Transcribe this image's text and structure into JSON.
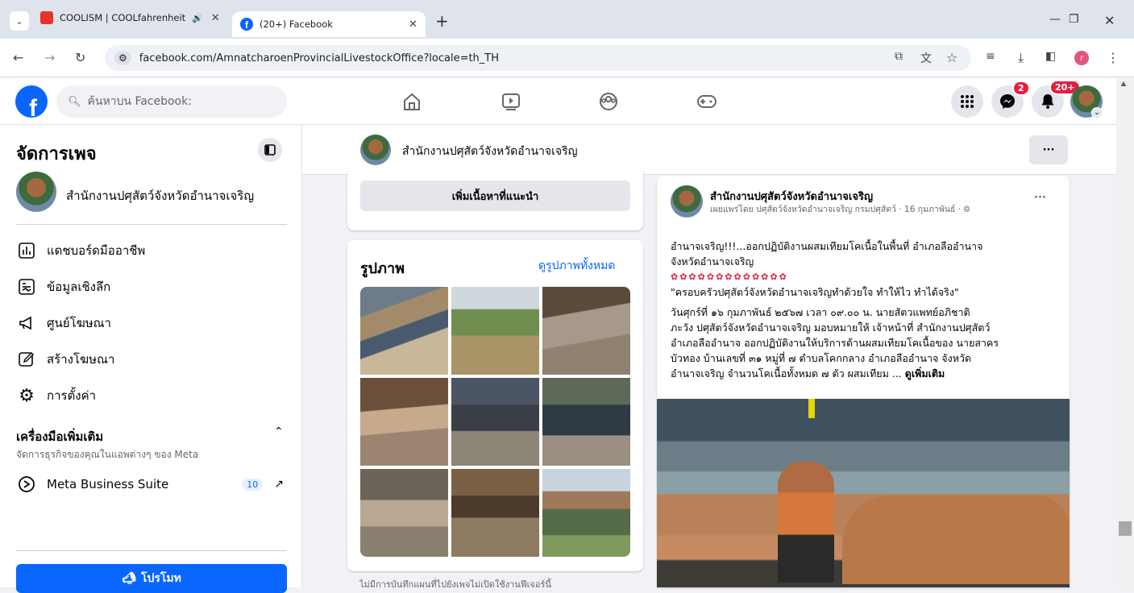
{
  "browser": {
    "tabs": [
      {
        "title": "COOLISM | COOLfahrenheit"
      },
      {
        "title": "(20+) Facebook"
      }
    ],
    "new_tab": "+",
    "url": "facebook.com/AmnatcharoenProvincialLivestockOffice?locale=th_TH"
  },
  "fb": {
    "search_placeholder": "ค้นหาบน Facebook:",
    "messenger_badge": "2",
    "notif_badge": "20+"
  },
  "left": {
    "title": "จัดการเพจ",
    "page_name": "สำนักงานปศุสัตว์จังหวัดอำนาจเจริญ",
    "menu": [
      {
        "label": "แดชบอร์ดมืออาชีพ",
        "icon": "dashboard-icon"
      },
      {
        "label": "ข้อมูลเชิงลึก",
        "icon": "insights-icon"
      },
      {
        "label": "ศูนย์โฆษณา",
        "icon": "megaphone-icon"
      },
      {
        "label": "สร้างโฆษณา",
        "icon": "edit-icon"
      },
      {
        "label": "การตั้งค่า",
        "icon": "gear-icon"
      }
    ],
    "tools_title": "เครื่องมือเพิ่มเติม",
    "tools_sub": "จัดการธุรกิจของคุณในแอพต่างๆ ของ Meta",
    "mbs_label": "Meta Business Suite",
    "mbs_count": "10",
    "promote": "โปรโมท"
  },
  "page_header": {
    "name": "สำนักงานปศุสัตว์จังหวัดอำนาจเจริญ",
    "more": "···"
  },
  "recommend_button": "เพิ่มเนื้อหาที่แนะนำ",
  "photos": {
    "title": "รูปภาพ",
    "see_all": "ดูรูปภาพทั้งหมด",
    "bottom_text": "ไม่มีการบันทึกแผนที่ไปยังเพจไม่เปิดใช้งานฟีเจอร์นี้"
  },
  "post": {
    "author": "สำนักงานปศุสัตว์จังหวัดอำนาจเจริญ",
    "meta": "เผยแพร่โดย ปศุสัตว์จังหวัดอำนาจเจริญ กรมปศุสัตว์ · 16 กุมภาพันธ์ ·",
    "line1": "อำนาจเจริญ!!!...ออกปฏิบัติงานผสมเทียมโคเนื้อในพื้นที่ อำเภอลืออำนาจ",
    "line2": "จังหวัดอำนาจเจริญ",
    "quote": "\"ครอบครัวปศุสัตว์จังหวัดอำนาจเจริญทำด้วยใจ ทำให้ไว ทำได้จริง\"",
    "body": [
      "วันศุกร์ที่ ๑๖ กุมภาพันธ์ ๒๕๖๗ เวลา ๐๙.๐๐ น. นายสัตวแพทย์อภิชาติ",
      "ภะวัง ปศุสัตว์จังหวัดอำนาจเจริญ มอบหมายให้ เจ้าหน้าที่ สำนักงานปศุสัตว์",
      "อำเภอลืออำนาจ ออกปฏิบัติงานให้บริการด้านผสมเทียมโคเนื้อของ นายสาคร",
      "บัวทอง บ้านเลขที่ ๓๑ หมู่ที่ ๗ ตำบลโคกกลาง อำเภอลืออำนาจ จังหวัด",
      "อำนาจเจริญ จำนวนโคเนื้อทั้งหมด ๗ ตัว ผสมเทียม ..."
    ],
    "see_more": "ดูเพิ่มเติม",
    "more": "···"
  }
}
